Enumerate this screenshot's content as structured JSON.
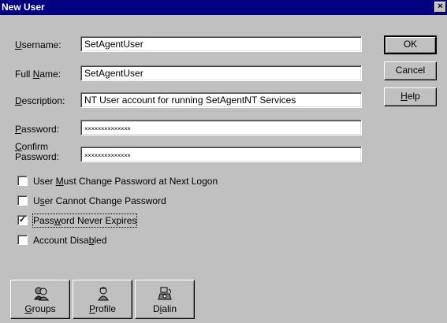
{
  "window": {
    "title": "New User",
    "close_glyph": "×"
  },
  "fields": {
    "username": {
      "label_ul": "U",
      "label_rest": "sername:",
      "value": "SetAgentUser"
    },
    "full_name": {
      "label_pre": "Full ",
      "label_ul": "N",
      "label_rest": "ame:",
      "value": "SetAgentUser"
    },
    "description": {
      "label_ul": "D",
      "label_rest": "escription:",
      "value": "NT User account for running SetAgentNT Services"
    },
    "password": {
      "label_ul": "P",
      "label_rest": "assword:",
      "value": "××××××××××××××"
    },
    "confirm_password": {
      "label_ul": "C",
      "label_rest": "onfirm",
      "label_line2": "Password:",
      "value": "××××××××××××××"
    }
  },
  "buttons": {
    "ok": "OK",
    "cancel": "Cancel",
    "help_ul": "H",
    "help_rest": "elp"
  },
  "checkboxes": [
    {
      "pre": "User ",
      "ul": "M",
      "post": "ust Change Password at Next Logon",
      "checked": false
    },
    {
      "pre": "U",
      "ul": "s",
      "post": "er Cannot Change Password",
      "checked": false
    },
    {
      "pre": "Pass",
      "ul": "w",
      "post": "ord Never Expires",
      "checked": true
    },
    {
      "pre": "Account Disa",
      "ul": "b",
      "post": "led",
      "checked": false
    }
  ],
  "check_glyph": "✓",
  "bottom_buttons": {
    "groups": {
      "icon": "groups-icon",
      "ul": "G",
      "rest": "roups"
    },
    "profile": {
      "icon": "profile-icon",
      "ul": "P",
      "rest": "rofile"
    },
    "dialin": {
      "icon": "dialin-icon",
      "pre": "D",
      "ul": "i",
      "rest": "alin"
    }
  }
}
